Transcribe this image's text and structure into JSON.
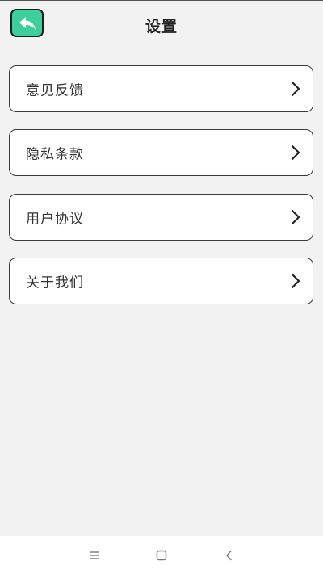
{
  "header": {
    "title": "设置",
    "back_icon": "reply-arrow-icon",
    "accent_color": "#3ccf9c"
  },
  "menu": {
    "items": [
      {
        "label": "意见反馈",
        "icon": "chevron-right-icon"
      },
      {
        "label": "隐私条款",
        "icon": "chevron-right-icon"
      },
      {
        "label": "用户协议",
        "icon": "chevron-right-icon"
      },
      {
        "label": "关于我们",
        "icon": "chevron-right-icon"
      }
    ]
  },
  "system_nav": {
    "buttons": [
      "menu-icon",
      "home-icon",
      "back-icon"
    ]
  }
}
